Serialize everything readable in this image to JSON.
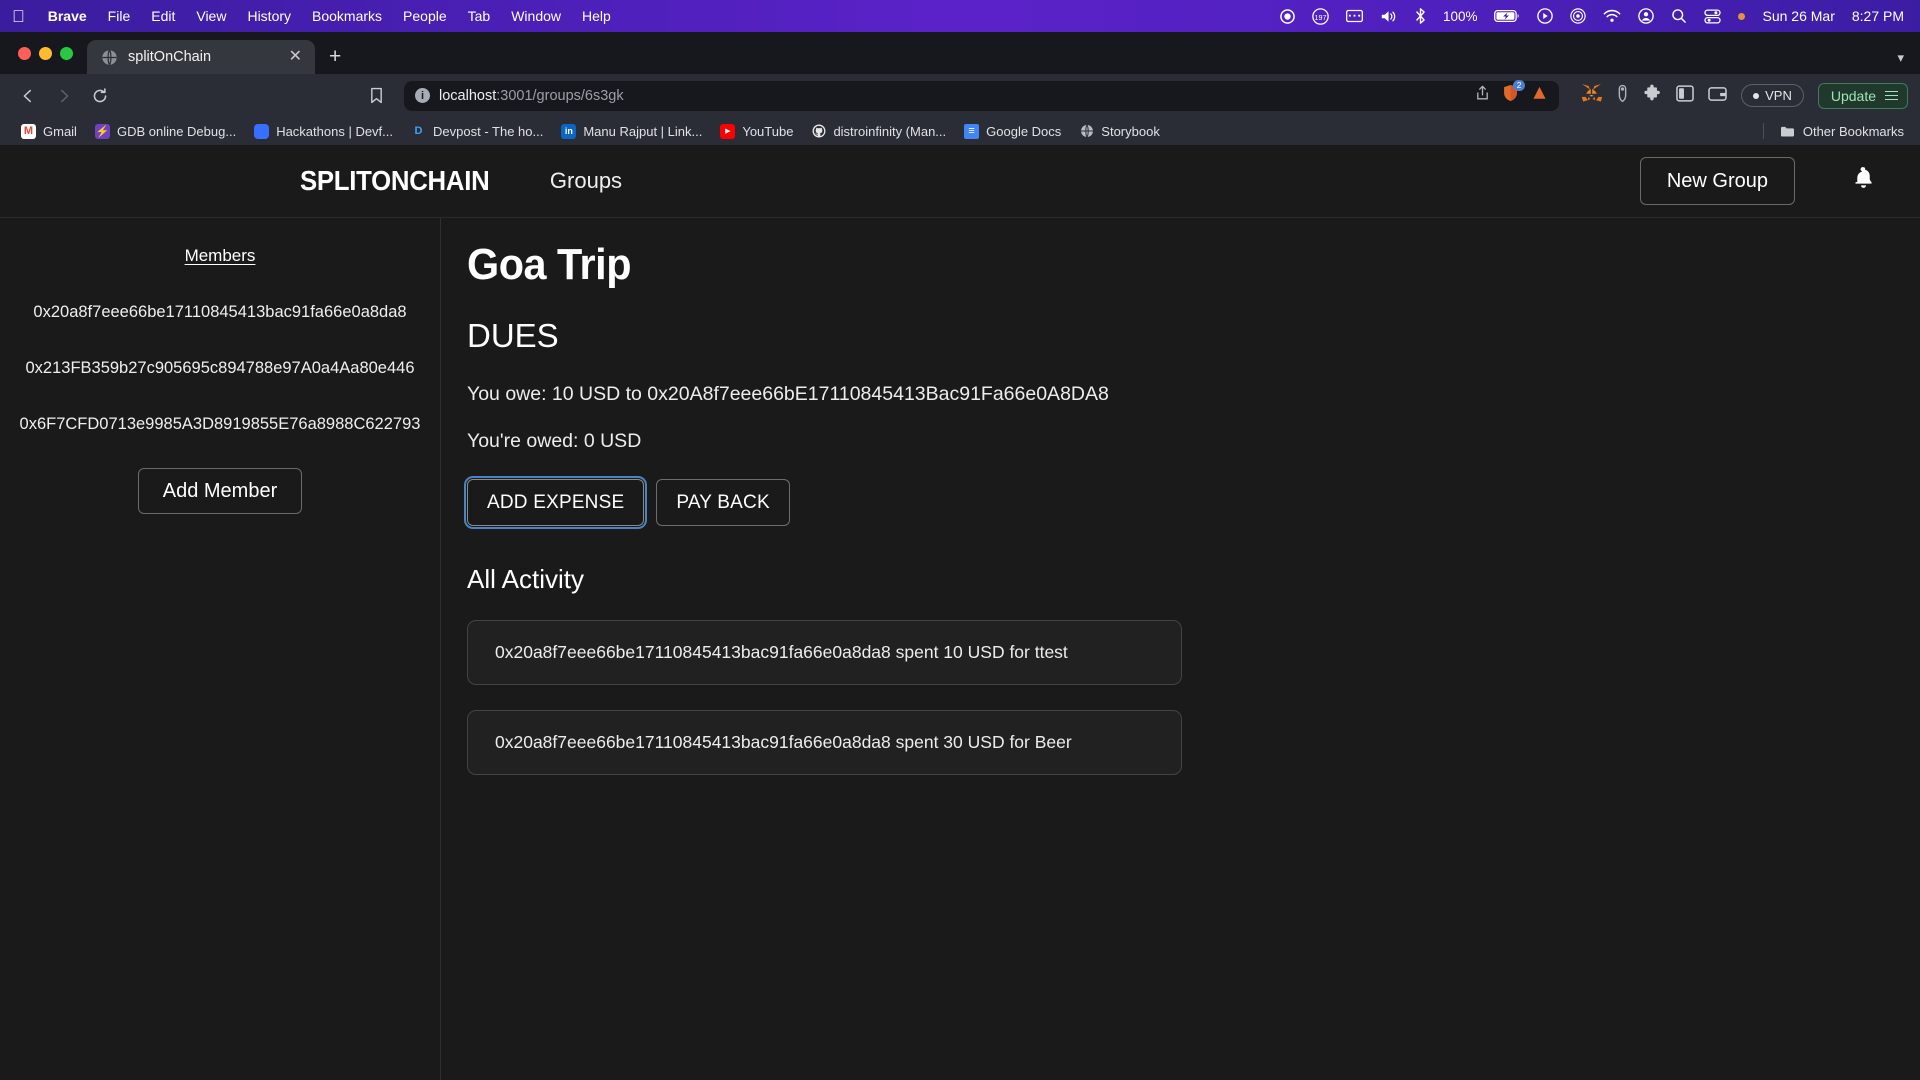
{
  "menubar": {
    "apple": "",
    "items": [
      {
        "label": "Brave",
        "bold": true
      },
      {
        "label": "File",
        "bold": false
      },
      {
        "label": "Edit",
        "bold": false
      },
      {
        "label": "View",
        "bold": false
      },
      {
        "label": "History",
        "bold": false
      },
      {
        "label": "Bookmarks",
        "bold": false
      },
      {
        "label": "People",
        "bold": false
      },
      {
        "label": "Tab",
        "bold": false
      },
      {
        "label": "Window",
        "bold": false
      },
      {
        "label": "Help",
        "bold": false
      }
    ],
    "status": {
      "record_icon": "record-icon",
      "stats_icon": "stats-counter-icon",
      "stats_value": "197",
      "keyboard_icon": "keyboard-icon",
      "volume_icon": "volume-icon",
      "bluetooth_icon": "bluetooth-icon",
      "battery_percent": "100%",
      "battery_icon": "battery-charging-icon",
      "play_icon": "play-circle-icon",
      "airplay_icon": "airdrop-icon",
      "wifi_icon": "wifi-icon",
      "account_icon": "account-circle-icon",
      "search_icon": "spotlight-search-icon",
      "controlcenter_icon": "control-center-icon",
      "notification_dot": "orange-status-dot",
      "date": "Sun 26 Mar",
      "time": "8:27 PM"
    }
  },
  "browser": {
    "tab": {
      "title": "splitOnChain",
      "favicon": "globe-icon",
      "close_icon": "close-icon"
    },
    "new_tab_icon": "plus-icon",
    "tabstrip_menu_icon": "chevron-down-icon",
    "nav": {
      "back_icon": "back-arrow-icon",
      "forward_icon": "forward-arrow-icon",
      "reload_icon": "reload-icon",
      "bookmark_icon": "bookmark-icon"
    },
    "url": {
      "info_icon": "not-secure-info-icon",
      "host": "localhost",
      "path": ":3001/groups/6s3gk"
    },
    "url_actions": {
      "share_icon": "share-icon",
      "shield_icon": "brave-shields-icon",
      "shield_count": "2",
      "leo_icon": "brave-leo-icon"
    },
    "toolbar_right": {
      "metamask_icon": "metamask-fox-icon",
      "wallet_icon": "brave-wallet-icon",
      "extensions_icon": "extensions-puzzle-icon",
      "sidebar_icon": "sidebar-toggle-icon",
      "card_icon": "brave-rewards-icon",
      "vpn_label": "VPN",
      "update_label": "Update",
      "menu_icon": "hamburger-menu-icon"
    },
    "bookmarks": [
      {
        "label": "Gmail",
        "icon": "gmail-icon",
        "icon_glyph": "M",
        "bg": "#ffffff",
        "fg": "#ea4335"
      },
      {
        "label": "GDB online Debug...",
        "icon": "gdb-icon",
        "icon_glyph": "⚡",
        "bg": "#6f42c1",
        "fg": "#ffffff"
      },
      {
        "label": "Hackathons | Devf...",
        "icon": "devfolio-icon",
        "icon_glyph": "",
        "bg": "#3770ff",
        "fg": "#ffffff"
      },
      {
        "label": "Devpost - The ho...",
        "icon": "devpost-icon",
        "icon_glyph": "D",
        "bg": "transparent",
        "fg": "#3aa0ff"
      },
      {
        "label": "Manu Rajput | Link...",
        "icon": "linkedin-icon",
        "icon_glyph": "in",
        "bg": "#0a66c2",
        "fg": "#ffffff"
      },
      {
        "label": "YouTube",
        "icon": "youtube-icon",
        "icon_glyph": "▶",
        "bg": "#ff0000",
        "fg": "#ffffff"
      },
      {
        "label": "distroinfinity (Man...",
        "icon": "github-icon",
        "icon_glyph": "",
        "bg": "transparent",
        "fg": "#e8e8e8"
      },
      {
        "label": "Google Docs",
        "icon": "google-docs-icon",
        "icon_glyph": "≡",
        "bg": "#4285f4",
        "fg": "#ffffff"
      },
      {
        "label": "Storybook",
        "icon": "globe-icon",
        "icon_glyph": "",
        "bg": "transparent",
        "fg": "#b9bcc2"
      }
    ],
    "other_bookmarks": {
      "label": "Other Bookmarks",
      "icon": "folder-icon"
    }
  },
  "app": {
    "brand": "SPLITONCHAIN",
    "nav_label": "Groups",
    "new_group_label": "New Group",
    "bell_icon": "notification-bell-icon",
    "sidebar": {
      "title": "Members",
      "members": [
        "0x20a8f7eee66be17110845413bac91fa66e0a8da8",
        "0x213FB359b27c905695c894788e97A0a4Aa80e446",
        "0x6F7CFD0713e9985A3D8919855E76a8988C622793"
      ],
      "add_member_label": "Add Member"
    },
    "main": {
      "group_title": "Goa Trip",
      "dues_heading": "DUES",
      "you_owe": "You owe: 10 USD to 0x20A8f7eee66bE17110845413Bac91Fa66e0A8DA8",
      "youre_owed": "You're owed: 0 USD",
      "add_expense_label": "ADD EXPENSE",
      "pay_back_label": "PAY BACK",
      "activity_heading": "All Activity",
      "activities": [
        "0x20a8f7eee66be17110845413bac91fa66e0a8da8 spent 10 USD for ttest",
        "0x20a8f7eee66be17110845413bac91fa66e0a8da8 spent 30 USD for Beer"
      ]
    }
  },
  "colors": {
    "focus_ring": "#4a82c4",
    "update_green": "#9fe3b8",
    "menubar_purple": "#4a1fb5"
  }
}
